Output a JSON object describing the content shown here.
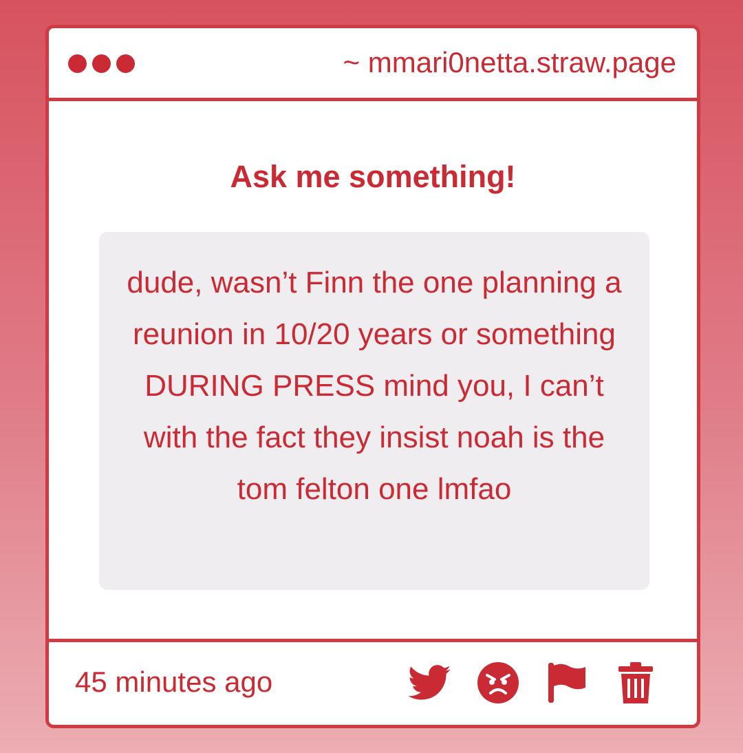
{
  "window": {
    "url": "~ mmari0netta.straw.page"
  },
  "main": {
    "heading": "Ask me something!",
    "question": "dude, wasn’t Finn the one planning a reunion in 10/20 years or something DURING PRESS mind you, I can’t with the fact they insist noah is the tom felton one lmfao"
  },
  "footer": {
    "timestamp": "45 minutes ago",
    "actions": [
      "twitter-icon",
      "angry-face-icon",
      "flag-icon",
      "trash-icon"
    ]
  },
  "colors": {
    "accent": "#c92a33",
    "border": "#cf3a43",
    "question_bg": "#efedef"
  }
}
